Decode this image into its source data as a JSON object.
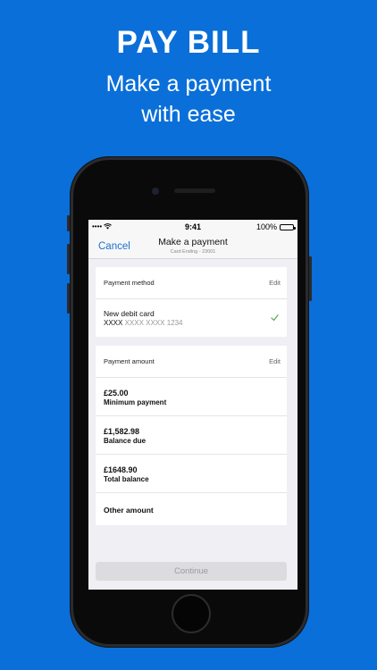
{
  "promo": {
    "headline": "PAY BILL",
    "sub_line1": "Make a payment",
    "sub_line2": "with ease"
  },
  "status_bar": {
    "signal": "••••",
    "time": "9:41",
    "battery": "100%"
  },
  "nav": {
    "cancel_label": "Cancel",
    "title": "Make a payment",
    "subtitle": "Card Ending - 23001"
  },
  "payment_method": {
    "header": "Payment method",
    "edit_label": "Edit",
    "card_name": "New debit card",
    "card_prefix": "XXXX",
    "card_masked": " XXXX XXXX 1234"
  },
  "payment_amount": {
    "header": "Payment amount",
    "edit_label": "Edit",
    "options": [
      {
        "value": "£25.00",
        "label": "Minimum payment"
      },
      {
        "value": "£1,582.98",
        "label": "Balance due"
      },
      {
        "value": "£1648.90",
        "label": "Total balance"
      }
    ],
    "other_label": "Other amount"
  },
  "continue_label": "Continue",
  "colors": {
    "background": "#0a6fd9",
    "accent": "#1e70cf",
    "check": "#4cae4c"
  }
}
